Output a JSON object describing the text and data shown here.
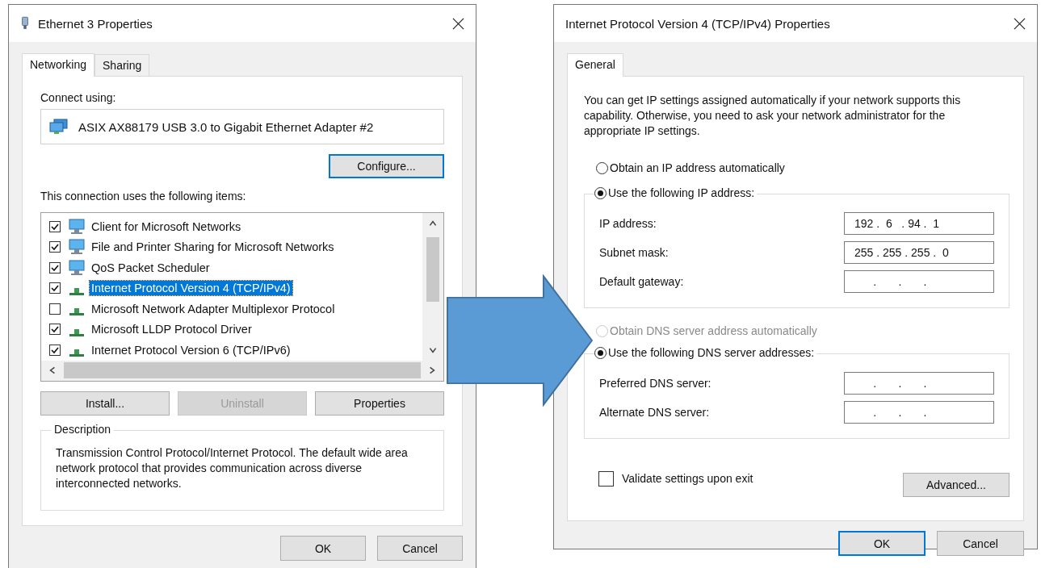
{
  "ethernet_window": {
    "title": "Ethernet 3 Properties",
    "tabs": [
      {
        "label": "Networking",
        "selected": true
      },
      {
        "label": "Sharing",
        "selected": false
      }
    ],
    "connect_using_label": "Connect using:",
    "adapter": "ASIX AX88179 USB 3.0 to Gigabit Ethernet Adapter #2",
    "configure_button": {
      "label": "Configure...",
      "default": true
    },
    "items_label": "This connection uses the following items:",
    "items": [
      {
        "label": "Client for Microsoft Networks",
        "kind": "client",
        "checked": true,
        "selected": false
      },
      {
        "label": "File and Printer Sharing for Microsoft Networks",
        "kind": "client",
        "checked": true,
        "selected": false
      },
      {
        "label": "QoS Packet Scheduler",
        "kind": "client",
        "checked": true,
        "selected": false
      },
      {
        "label": "Internet Protocol Version 4 (TCP/IPv4)",
        "kind": "protocol",
        "checked": true,
        "selected": true
      },
      {
        "label": "Microsoft Network Adapter Multiplexor Protocol",
        "kind": "protocol",
        "checked": false,
        "selected": false
      },
      {
        "label": "Microsoft LLDP Protocol Driver",
        "kind": "protocol",
        "checked": true,
        "selected": false
      },
      {
        "label": "Internet Protocol Version 6 (TCP/IPv6)",
        "kind": "protocol",
        "checked": true,
        "selected": false
      }
    ],
    "item_buttons": [
      {
        "label": "Install...",
        "disabled": false
      },
      {
        "label": "Uninstall",
        "disabled": true
      },
      {
        "label": "Properties",
        "disabled": false
      }
    ],
    "description": {
      "legend": "Description",
      "text": "Transmission Control Protocol/Internet Protocol. The default wide area network protocol that provides communication across diverse interconnected networks."
    },
    "buttons": [
      {
        "label": "OK",
        "default": false
      },
      {
        "label": "Cancel",
        "default": false
      }
    ]
  },
  "ipv4_window": {
    "title": "Internet Protocol Version 4 (TCP/IPv4) Properties",
    "tabs": [
      {
        "label": "General",
        "selected": true
      }
    ],
    "intro": "You can get IP settings assigned automatically if your network supports this capability. Otherwise, you need to ask your network administrator for the appropriate IP settings.",
    "ip_auto": {
      "label": "Obtain an IP address automatically",
      "selected": false,
      "disabled": false
    },
    "ip_manual": {
      "label": "Use the following IP address:",
      "selected": true,
      "disabled": false
    },
    "ip_fields": [
      {
        "label": "IP address:",
        "value": "192 .  6   . 94 .  1"
      },
      {
        "label": "Subnet mask:",
        "value": "255 . 255 . 255 .  0"
      },
      {
        "label": "Default gateway:",
        "value": "      .       .       ."
      }
    ],
    "dns_auto": {
      "label": "Obtain DNS server address automatically",
      "selected": false,
      "disabled": true
    },
    "dns_manual": {
      "label": "Use the following DNS server addresses:",
      "selected": true,
      "disabled": false
    },
    "dns_fields": [
      {
        "label": "Preferred DNS server:",
        "value": "      .       .       ."
      },
      {
        "label": "Alternate DNS server:",
        "value": "      .       .       ."
      }
    ],
    "validate": {
      "label": "Validate settings upon exit",
      "checked": false
    },
    "advanced_button": "Advanced...",
    "buttons": [
      {
        "label": "OK",
        "default": true
      },
      {
        "label": "Cancel",
        "default": false
      }
    ]
  }
}
